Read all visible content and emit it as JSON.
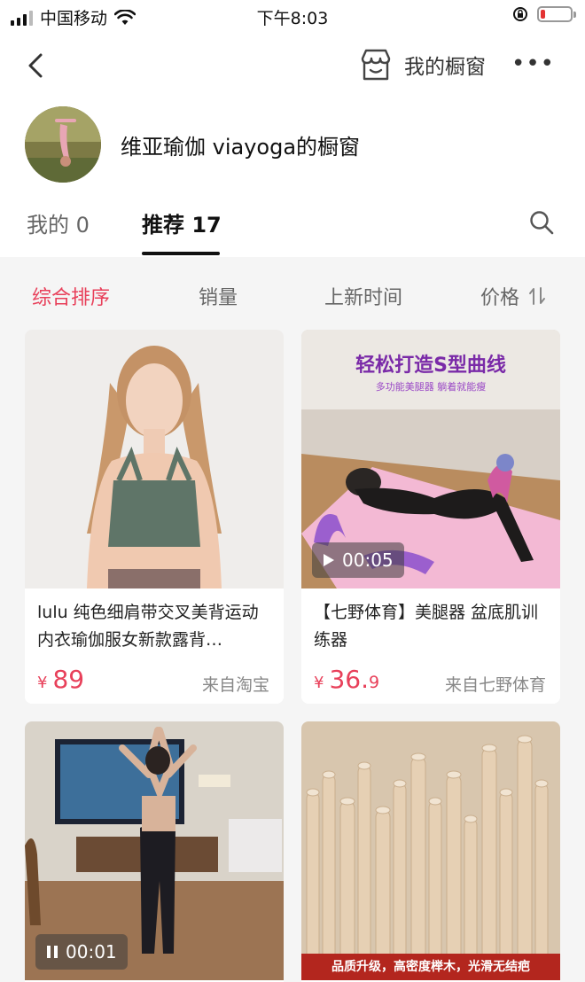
{
  "status_bar": {
    "carrier": "中国移动",
    "time": "下午8:03",
    "battery_color": "#e33333"
  },
  "nav": {
    "showcase_label": "我的橱窗",
    "more_label": "•••",
    "icons": {
      "back": "back-chevron-icon",
      "showcase": "storefront-icon",
      "more": "more-dots-icon"
    }
  },
  "profile": {
    "shop_name": "维亚瑜伽 viayoga的橱窗"
  },
  "tabs": {
    "mine": "我的 0",
    "recommended": "推荐 17",
    "active": "recommended"
  },
  "sort": {
    "comprehensive": "综合排序",
    "sales": "销量",
    "newest": "上新时间",
    "price": "价格",
    "active_color": "#e8405a"
  },
  "products": [
    {
      "title": "lulu 纯色细肩带交叉美背运动内衣瑜伽服女新款露背…",
      "currency": "¥",
      "price_int": "89",
      "price_dec": "",
      "source": "来自淘宝"
    },
    {
      "title": "【七野体育】美腿器 盆底肌训练器",
      "currency": "¥",
      "price_int": "36.",
      "price_dec": "9",
      "source": "来自七野体育",
      "image_text_title": "轻松打造S型曲线",
      "image_text_sub": "多功能美腿器 躺着就能瘦",
      "video_duration": "00:05"
    },
    {
      "video_duration": "00:01"
    },
    {
      "image_banner": "品质升级，高密度榉木，光滑无结疤"
    }
  ]
}
